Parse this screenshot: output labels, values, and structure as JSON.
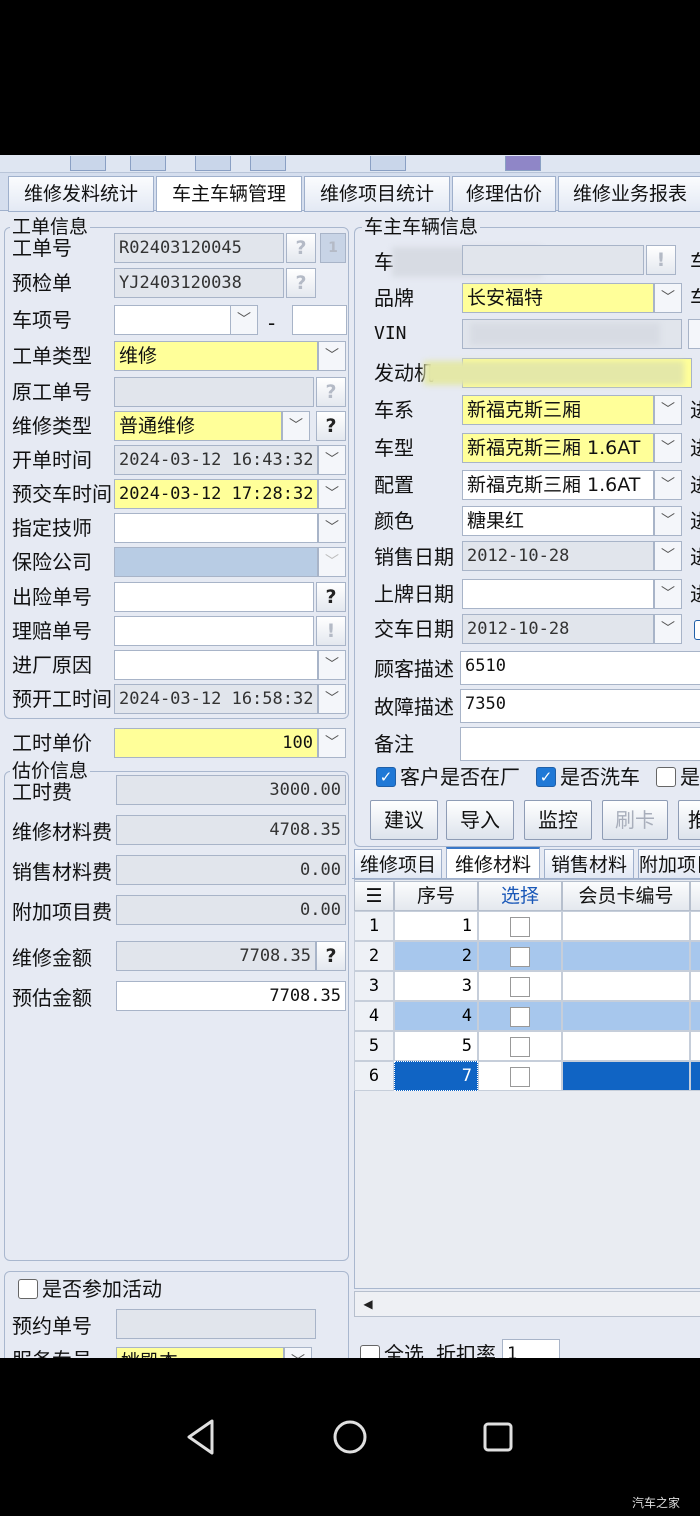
{
  "tabs": [
    "维修发料统计",
    "车主车辆管理",
    "维修项目统计",
    "修理估价",
    "维修业务报表"
  ],
  "work_order": {
    "title": "工单信息",
    "order_no_label": "工单号",
    "order_no": "R02403120045",
    "precheck_label": "预检单",
    "precheck_no": "YJ2403120038",
    "car_item_label": "车项号",
    "car_item_sep": "-",
    "order_type_label": "工单类型",
    "order_type": "维修",
    "orig_order_label": "原工单号",
    "repair_type_label": "维修类型",
    "repair_type": "普通维修",
    "open_time_label": "开单时间",
    "open_time": "2024-03-12 16:43:32",
    "delivery_time_label": "预交车时间",
    "delivery_time": "2024-03-12 17:28:32",
    "technician_label": "指定技师",
    "insurer_label": "保险公司",
    "claim_no_label": "出险单号",
    "settle_no_label": "理赔单号",
    "reason_label": "进厂原因",
    "start_time_label": "预开工时间",
    "start_time": "2024-03-12 16:58:32"
  },
  "labor_price": {
    "label": "工时单价",
    "value": "100"
  },
  "estimate": {
    "title": "估价信息",
    "labor_fee_label": "工时费",
    "labor_fee": "3000.00",
    "material_fee_label": "维修材料费",
    "material_fee": "4708.35",
    "sales_fee_label": "销售材料费",
    "sales_fee": "0.00",
    "extra_fee_label": "附加项目费",
    "extra_fee": "0.00",
    "repair_amount_label": "维修金额",
    "repair_amount": "7708.35",
    "estimate_amount_label": "预估金额",
    "estimate_amount": "7708.35"
  },
  "activity": {
    "checkbox_label": "是否参加活动",
    "booking_label": "预约单号",
    "advisor_label": "服务专员",
    "advisor_value": "姚殿杰"
  },
  "vehicle": {
    "title": "车主车辆信息",
    "plate_label": "车",
    "brand_label": "品牌",
    "brand": "长安福特",
    "vin_label": "VIN",
    "engine_label": "发动机",
    "series_label": "车系",
    "series": "新福克斯三厢",
    "model_label": "车型",
    "model": "新福克斯三厢 1.6AT",
    "config_label": "配置",
    "config": "新福克斯三厢 1.6AT",
    "color_label": "颜色",
    "color": "糖果红",
    "sale_date_label": "销售日期",
    "sale_date": "2012-10-28",
    "plate_date_label": "上牌日期",
    "delivery_date_label": "交车日期",
    "delivery_date": "2012-10-28",
    "customer_desc_label": "顾客描述",
    "customer_desc": "6510",
    "fault_desc_label": "故障描述",
    "fault_desc": "7350",
    "remark_label": "备注",
    "right_clip_1": "车",
    "right_clip_2": "车",
    "right_clip_3": "进",
    "right_clip_4": "进",
    "right_clip_5": "进",
    "right_clip_6": "进",
    "right_clip_7": "进",
    "right_clip_8": "进",
    "cb_in_factory": "客户是否在厂",
    "cb_wash": "是否洗车",
    "cb_more": "是"
  },
  "actions": [
    "建议",
    "导入",
    "监控",
    "刷卡",
    "推"
  ],
  "subtabs": [
    "维修项目",
    "维修材料",
    "销售材料",
    "附加项目"
  ],
  "grid": {
    "columns": [
      "序号",
      "选择",
      "会员卡编号"
    ],
    "rows": [
      {
        "idx": "1",
        "seq": "1"
      },
      {
        "idx": "2",
        "seq": "2"
      },
      {
        "idx": "3",
        "seq": "3"
      },
      {
        "idx": "4",
        "seq": "4"
      },
      {
        "idx": "5",
        "seq": "5"
      },
      {
        "idx": "6",
        "seq": "7"
      }
    ]
  },
  "bottom": {
    "select_all": "全选",
    "discount_label": "折扣率",
    "discount": "1"
  },
  "watermark": "汽车之家"
}
